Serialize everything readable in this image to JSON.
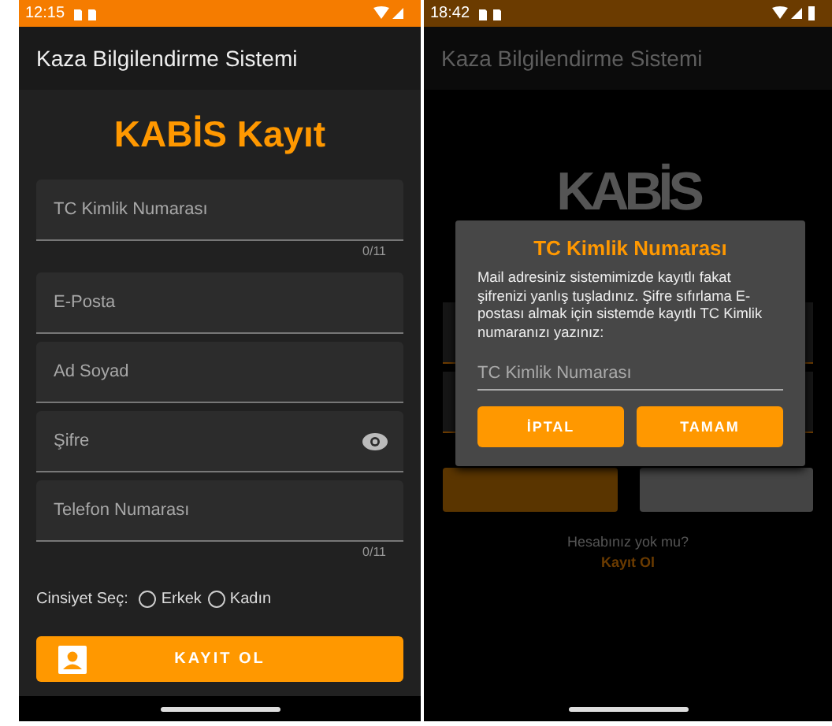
{
  "screens": [
    {
      "status_bar": {
        "time": "12:15",
        "dimmed": false
      },
      "app_bar": {
        "title": "Kaza Bilgilendirme Sistemi"
      },
      "heading": "KABİS Kayıt",
      "fields": [
        {
          "placeholder": "TC Kimlik Numarası",
          "counter": "0/11",
          "password": false
        },
        {
          "placeholder": "E-Posta",
          "password": false
        },
        {
          "placeholder": "Ad Soyad",
          "password": false
        },
        {
          "placeholder": "Şifre",
          "password": true
        },
        {
          "placeholder": "Telefon Numarası",
          "counter": "0/11",
          "password": false
        }
      ],
      "gender": {
        "label": "Cinsiyet Seç:",
        "options": [
          {
            "label": "Erkek",
            "selected": false
          },
          {
            "label": "Kadın",
            "selected": false
          }
        ]
      },
      "register_button": "KAYIT OL"
    },
    {
      "status_bar": {
        "time": "18:42",
        "dimmed": true
      },
      "app_bar": {
        "title": "Kaza Bilgilendirme Sistemi"
      },
      "logo": "KABİS",
      "signup_prompt": "Hesabınız yok mu?",
      "signup_link": "Kayıt Ol",
      "dialog": {
        "title": "TC Kimlik Numarası",
        "message": "Mail adresiniz sistemimizde kayıtlı fakat şifrenizi yanlış tuşladınız. Şifre sıfırlama E-postası almak için sistemde kayıtlı TC Kimlik numaranızı yazınız:",
        "placeholder": "TC Kimlik Numarası",
        "buttons": [
          "İPTAL",
          "TAMAM"
        ]
      }
    }
  ]
}
